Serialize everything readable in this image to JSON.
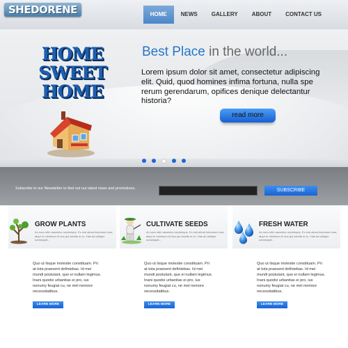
{
  "logo": "SHEDORENE",
  "nav": [
    "HOME",
    "NEWS",
    "GALLERY",
    "ABOUT",
    "CONTACT US"
  ],
  "hero": {
    "home_lines": [
      "HOME",
      "SWEET",
      "HOME"
    ],
    "tagline_main": "Best Place",
    "tagline_rest": " in the world...",
    "body": "Lorem ipsum dolor sit amet, consectetur adipiscing elit. Quid, quod homines infima fortuna, nulla spe rerum gerendarum, opifices denique delectantur historia?",
    "button": "read more",
    "slides": 5,
    "active_slide": 3
  },
  "newsletter": {
    "text": "Subscribe to our Newsletter to find out our latest news and promotions.",
    "input_value": "",
    "button": "SUBSCRIBE"
  },
  "features": [
    {
      "title": "GROW PLANTS",
      "icon": "plant-icon",
      "small": "An nam nibh assentior reprimique. Ex sint alirad indoctum mea, atqui re minimum et duo qui ancilla m cu. Has ad oblique consequat...",
      "body": "Quo ut lisque molestie constituam. Pri at tota praesent definiebas. Id mei mundi postulant, quo ei nullam legimus. Inani quodsi urbanitas ei pro, ius nonumy feugiat cu, ne mel nemore necessitatibus.",
      "button": "LEARN MORE"
    },
    {
      "title": "CULTIVATE SEEDS",
      "icon": "farmer-icon",
      "small": "An nam nibh assentior reprimique. Ex sint alirad indoctum mea, atqui re minimum et duo qui ancilla m cu. Has ad oblique consequat...",
      "body": "Quo ut lisque molestie constituam. Pri at tota praesent definiebas. Id mei mundi postulant, quo ei nullam legimus. Inani quodsi urbanitas ei pro, ius nonumy feugiat cu, ne mel nemore necessitatibus.",
      "button": "LEARN MORE"
    },
    {
      "title": "FRESH WATER",
      "icon": "water-drops-icon",
      "small": "An nam nibh assentior reprimique. Ex sint alirad indoctum mea, atqui re minimum et duo qui ancilla m cu. Has ad oblique consequat...",
      "body": "Quo ut lisque molestie constituam. Pri at tota praesent definiebas. Id mei mundi postulant, quo ei nullam legimus. Inani quodsi urbanitas ei pro, ius nonumy feugiat cu, ne mel nemore necessitatibus.",
      "button": "LEARN MORE"
    }
  ],
  "colors": {
    "accent": "#2677c8",
    "button": "#1a64d2",
    "newsletter_bg": "#8a8d91"
  }
}
